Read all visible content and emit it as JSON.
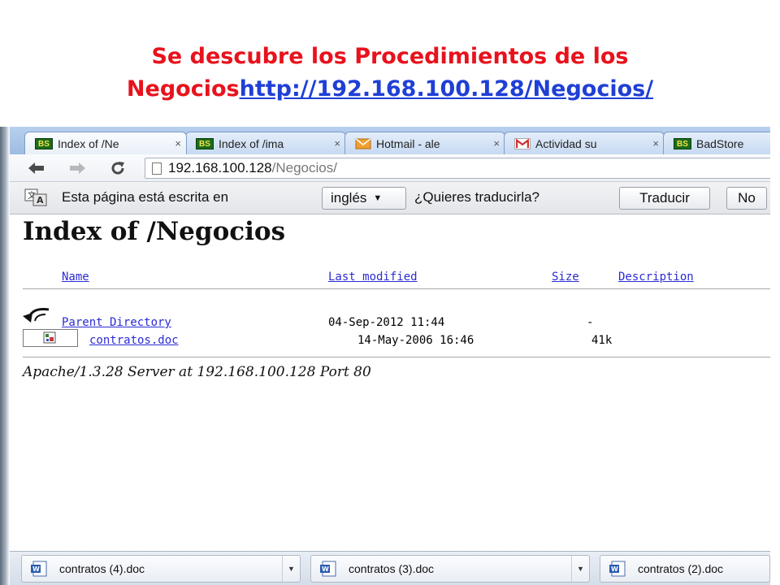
{
  "slide": {
    "title_line1": "Se descubre los Procedimientos de los",
    "title_line2_prefix": "Negocios",
    "title_line2_link": "http://192.168.100.128/Negocios/"
  },
  "colors": {
    "title_red": "#e8121c",
    "title_link_blue": "#1f3fd6",
    "listing_link_blue": "#2b2bd4"
  },
  "browser": {
    "tabs": [
      {
        "icon": "bs-icon",
        "title": "Index of /Ne",
        "active": true
      },
      {
        "icon": "bs-icon",
        "title": "Index of /ima",
        "active": false
      },
      {
        "icon": "mail-icon",
        "title": "Hotmail - ale",
        "active": false
      },
      {
        "icon": "gmail-icon",
        "title": "Actividad su",
        "active": false
      },
      {
        "icon": "bs-icon",
        "title": "BadStore",
        "active": false
      }
    ],
    "bs_badge": "BS",
    "close_glyph": "×",
    "address": {
      "host": "192.168.100.128",
      "path": "/Negocios/"
    },
    "translate_bar": {
      "message": "Esta página está escrita en",
      "language": "inglés",
      "question": "¿Quieres traducirla?",
      "translate_label": "Traducir",
      "no_label": "No"
    }
  },
  "page": {
    "heading": "Index of /Negocios",
    "columns": {
      "name": "Name",
      "last_modified": "Last modified",
      "size": "Size",
      "description": "Description"
    },
    "rows": [
      {
        "name": "Parent Directory",
        "modified": "04-Sep-2012 11:44",
        "size": "-"
      },
      {
        "name": "contratos.doc",
        "modified": "14-May-2006 16:46",
        "size": "41k"
      }
    ],
    "footer": "Apache/1.3.28 Server at 192.168.100.128 Port 80"
  },
  "downloads": [
    {
      "filename": "contratos (4).doc"
    },
    {
      "filename": "contratos (3).doc"
    },
    {
      "filename": "contratos (2).doc"
    }
  ]
}
